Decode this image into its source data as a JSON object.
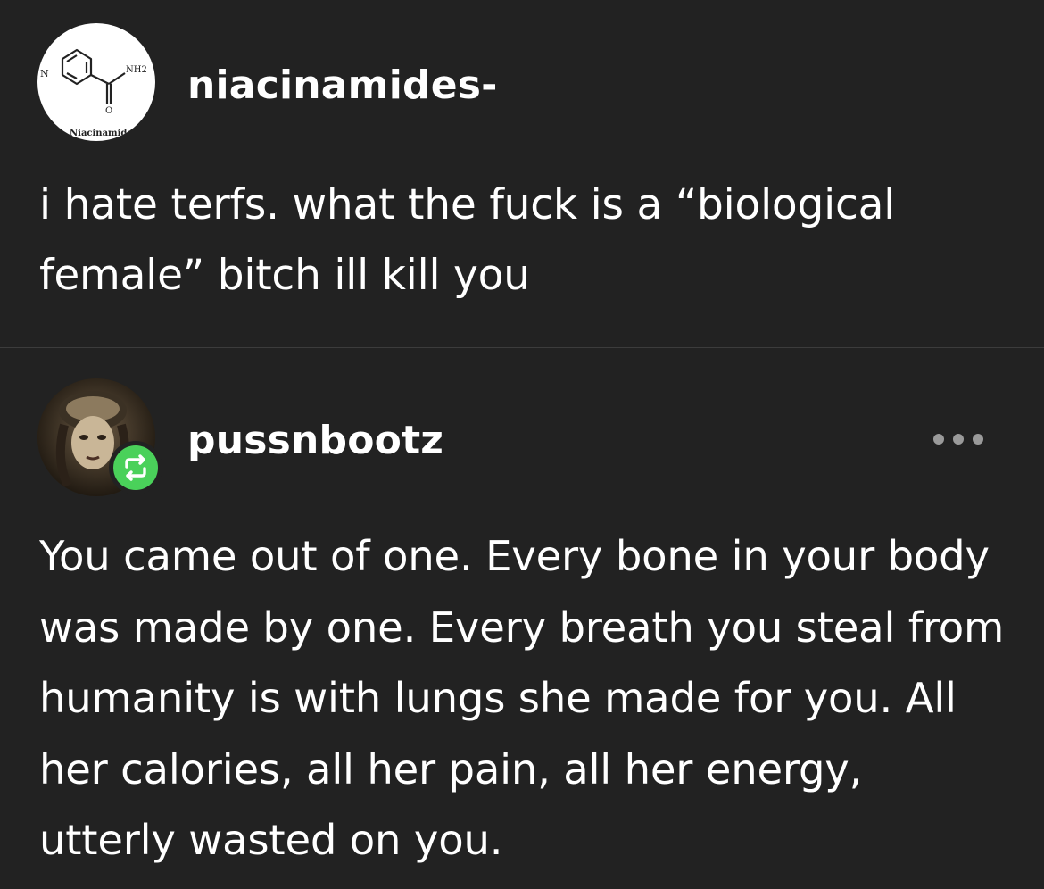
{
  "posts": [
    {
      "username": "niacinamides-",
      "avatar": {
        "icon": "niacinamide-molecule-icon",
        "caption": "Niacinamide",
        "labels": [
          "N",
          "NH2",
          "O"
        ]
      },
      "text": "i hate terfs. what the fuck is a “biological female” bitch ill kill you"
    },
    {
      "username": "pussnbootz",
      "avatar": {
        "icon": "portrait-photo",
        "badge": "reblog-icon"
      },
      "menu_icon": "more-options-icon",
      "text": "You came out of one. Every bone in your body was made by one. Every breath you steal from humanity is with lungs she made for you. All her calories, all her pain, all her energy, utterly wasted on you."
    }
  ],
  "colors": {
    "background": "#222222",
    "text": "#ffffff",
    "divider": "#3c3c3c",
    "reblog_badge": "#4ad15a",
    "menu_dots": "#9a9a9a"
  }
}
